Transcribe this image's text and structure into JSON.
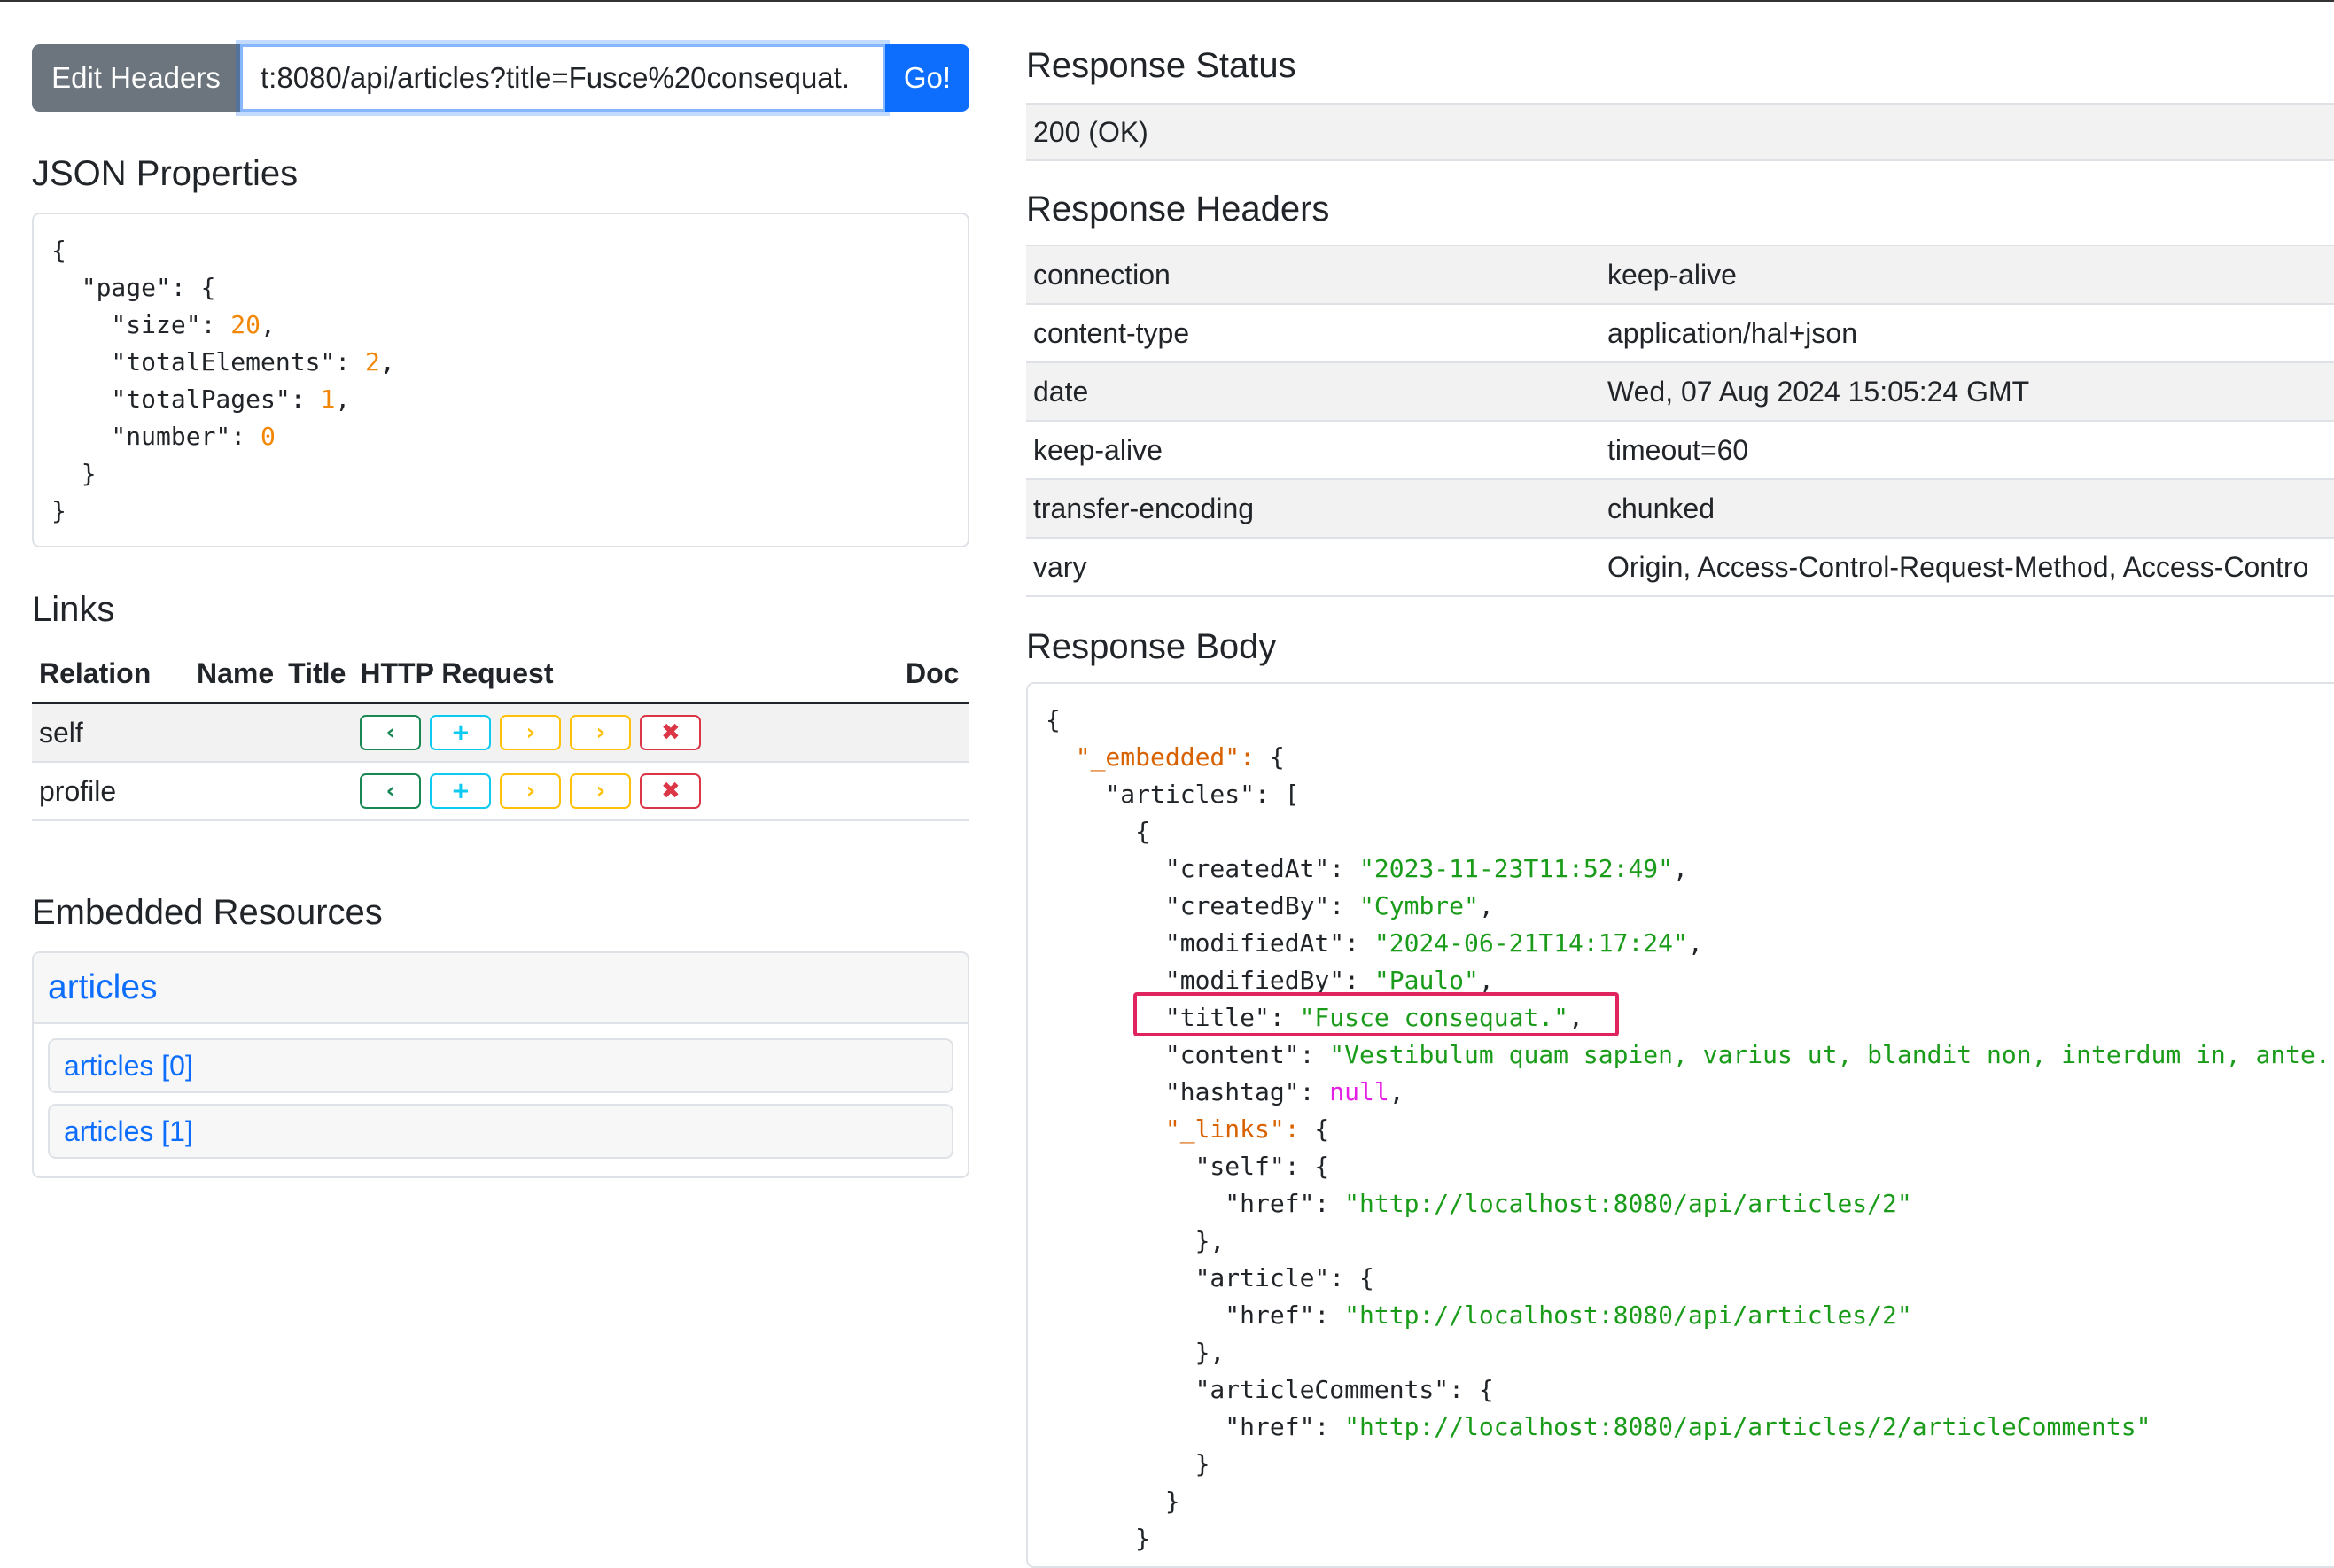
{
  "request": {
    "edit_headers_label": "Edit Headers",
    "url_value": "t:8080/api/articles?title=Fusce%20consequat.",
    "go_label": "Go!"
  },
  "json_properties": {
    "title": "JSON Properties",
    "lines": [
      [
        {
          "t": "{",
          "c": "k"
        }
      ],
      [
        {
          "t": "  \"page\": {",
          "c": "k"
        }
      ],
      [
        {
          "t": "    \"size\": ",
          "c": "k"
        },
        {
          "t": "20",
          "c": "num"
        },
        {
          "t": ",",
          "c": "k"
        }
      ],
      [
        {
          "t": "    \"totalElements\": ",
          "c": "k"
        },
        {
          "t": "2",
          "c": "num"
        },
        {
          "t": ",",
          "c": "k"
        }
      ],
      [
        {
          "t": "    \"totalPages\": ",
          "c": "k"
        },
        {
          "t": "1",
          "c": "num"
        },
        {
          "t": ",",
          "c": "k"
        }
      ],
      [
        {
          "t": "    \"number\": ",
          "c": "k"
        },
        {
          "t": "0",
          "c": "num"
        }
      ],
      [
        {
          "t": "  }",
          "c": "k"
        }
      ],
      [
        {
          "t": "}",
          "c": "k"
        }
      ]
    ]
  },
  "links": {
    "title": "Links",
    "headers": {
      "relation": "Relation",
      "name": "Name",
      "title": "Title",
      "http_request": "HTTP Request",
      "doc": "Doc"
    },
    "rows": [
      {
        "relation": "self",
        "name": "",
        "title": "",
        "doc": ""
      },
      {
        "relation": "profile",
        "name": "",
        "title": "",
        "doc": ""
      }
    ],
    "icons": [
      "chevron-left-icon",
      "plus-icon",
      "chevron-right-icon",
      "chevron-right-icon",
      "x-icon"
    ]
  },
  "embedded": {
    "title": "Embedded Resources",
    "card_title": "articles",
    "items": [
      "articles [0]",
      "articles [1]"
    ]
  },
  "response_status": {
    "title": "Response Status",
    "value": "200 (OK)"
  },
  "response_headers": {
    "title": "Response Headers",
    "rows": [
      {
        "name": "connection",
        "value": "keep-alive"
      },
      {
        "name": "content-type",
        "value": "application/hal+json"
      },
      {
        "name": "date",
        "value": "Wed, 07 Aug 2024 15:05:24 GMT"
      },
      {
        "name": "keep-alive",
        "value": "timeout=60"
      },
      {
        "name": "transfer-encoding",
        "value": "chunked"
      },
      {
        "name": "vary",
        "value": "Origin, Access-Control-Request-Method, Access-Contro"
      }
    ]
  },
  "response_body": {
    "title": "Response Body",
    "lines": [
      [
        {
          "t": "{",
          "c": "k"
        }
      ],
      [
        {
          "t": "  ",
          "c": "k"
        },
        {
          "t": "\"_embedded\":",
          "c": "ekey"
        },
        {
          "t": " {",
          "c": "k"
        }
      ],
      [
        {
          "t": "    \"articles\": [",
          "c": "k"
        }
      ],
      [
        {
          "t": "      {",
          "c": "k"
        }
      ],
      [
        {
          "t": "        \"createdAt\": ",
          "c": "k"
        },
        {
          "t": "\"2023-11-23T11:52:49\"",
          "c": "str"
        },
        {
          "t": ",",
          "c": "k"
        }
      ],
      [
        {
          "t": "        \"createdBy\": ",
          "c": "k"
        },
        {
          "t": "\"Cymbre\"",
          "c": "str"
        },
        {
          "t": ",",
          "c": "k"
        }
      ],
      [
        {
          "t": "        \"modifiedAt\": ",
          "c": "k"
        },
        {
          "t": "\"2024-06-21T14:17:24\"",
          "c": "str"
        },
        {
          "t": ",",
          "c": "k"
        }
      ],
      [
        {
          "t": "        \"modifiedBy\": ",
          "c": "k"
        },
        {
          "t": "\"Paulo\"",
          "c": "str"
        },
        {
          "t": ",",
          "c": "k"
        }
      ],
      [
        {
          "t": "        \"title\": ",
          "c": "k"
        },
        {
          "t": "\"Fusce consequat.\"",
          "c": "str"
        },
        {
          "t": ",",
          "c": "k"
        }
      ],
      [
        {
          "t": "        \"content\": ",
          "c": "k"
        },
        {
          "t": "\"Vestibulum quam sapien, varius ut, blandit non, interdum in, ante.",
          "c": "str"
        }
      ],
      [
        {
          "t": "        \"hashtag\": ",
          "c": "k"
        },
        {
          "t": "null",
          "c": "nul"
        },
        {
          "t": ",",
          "c": "k"
        }
      ],
      [
        {
          "t": "        ",
          "c": "k"
        },
        {
          "t": "\"_links\":",
          "c": "ekey"
        },
        {
          "t": " {",
          "c": "k"
        }
      ],
      [
        {
          "t": "          \"self\": {",
          "c": "k"
        }
      ],
      [
        {
          "t": "            \"href\": ",
          "c": "k"
        },
        {
          "t": "\"http://localhost:8080/api/articles/2\"",
          "c": "str"
        }
      ],
      [
        {
          "t": "          },",
          "c": "k"
        }
      ],
      [
        {
          "t": "          \"article\": {",
          "c": "k"
        }
      ],
      [
        {
          "t": "            \"href\": ",
          "c": "k"
        },
        {
          "t": "\"http://localhost:8080/api/articles/2\"",
          "c": "str"
        }
      ],
      [
        {
          "t": "          },",
          "c": "k"
        }
      ],
      [
        {
          "t": "          \"articleComments\": {",
          "c": "k"
        }
      ],
      [
        {
          "t": "            \"href\": ",
          "c": "k"
        },
        {
          "t": "\"http://localhost:8080/api/articles/2/articleComments\"",
          "c": "str"
        }
      ],
      [
        {
          "t": "          }",
          "c": "k"
        }
      ],
      [
        {
          "t": "        }",
          "c": "k"
        }
      ],
      [
        {
          "t": "      }",
          "c": "k"
        }
      ]
    ]
  },
  "colors": {
    "primary": "#0d6efd",
    "secondary": "#6c757d",
    "highlight": "#e0245e",
    "number": "#f28705",
    "string": "#1a9c1a",
    "null": "#e320e3",
    "embedded_key": "#d96200"
  }
}
